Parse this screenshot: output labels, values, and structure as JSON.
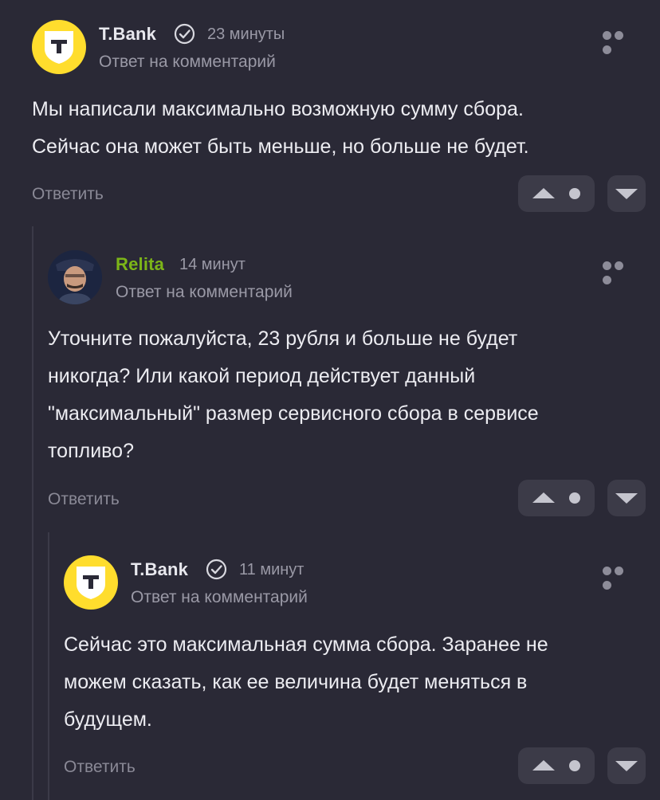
{
  "comments": [
    {
      "author": "T.Bank",
      "verified": true,
      "time": "23 минуты",
      "subtitle": "Ответ на комментарий",
      "lines": [
        "Мы написали максимально возможную сумму сбора.",
        "Сейчас она может быть меньше, но больше не будет."
      ],
      "reply_label": "Ответить",
      "score": "•"
    },
    {
      "author": "Relita",
      "verified": false,
      "time": "14 минут",
      "subtitle": "Ответ на комментарий",
      "lines": [
        "Уточните пожалуйста, 23 рубля и больше не будет",
        "никогда? Или какой период действует данный",
        "\"максимальный\" размер сервисного сбора в сервисе",
        "топливо?"
      ],
      "reply_label": "Ответить",
      "score": "•"
    },
    {
      "author": "T.Bank",
      "verified": true,
      "time": "11 минут",
      "subtitle": "Ответ на комментарий",
      "lines": [
        "Сейчас это максимальная сумма сбора. Заранее не",
        "можем сказать, как ее величина будет меняться в",
        "будущем."
      ],
      "reply_label": "Ответить",
      "score": "•"
    }
  ],
  "icons": {
    "bank_logo": "t-bank-logo-icon",
    "verified": "verified-check-icon",
    "more": "more-dots-icon",
    "upvote": "upvote-icon",
    "downvote": "downvote-icon"
  },
  "colors": {
    "background": "#2a2936",
    "brand_yellow": "#ffdd2d",
    "author_green": "#7cb518"
  }
}
